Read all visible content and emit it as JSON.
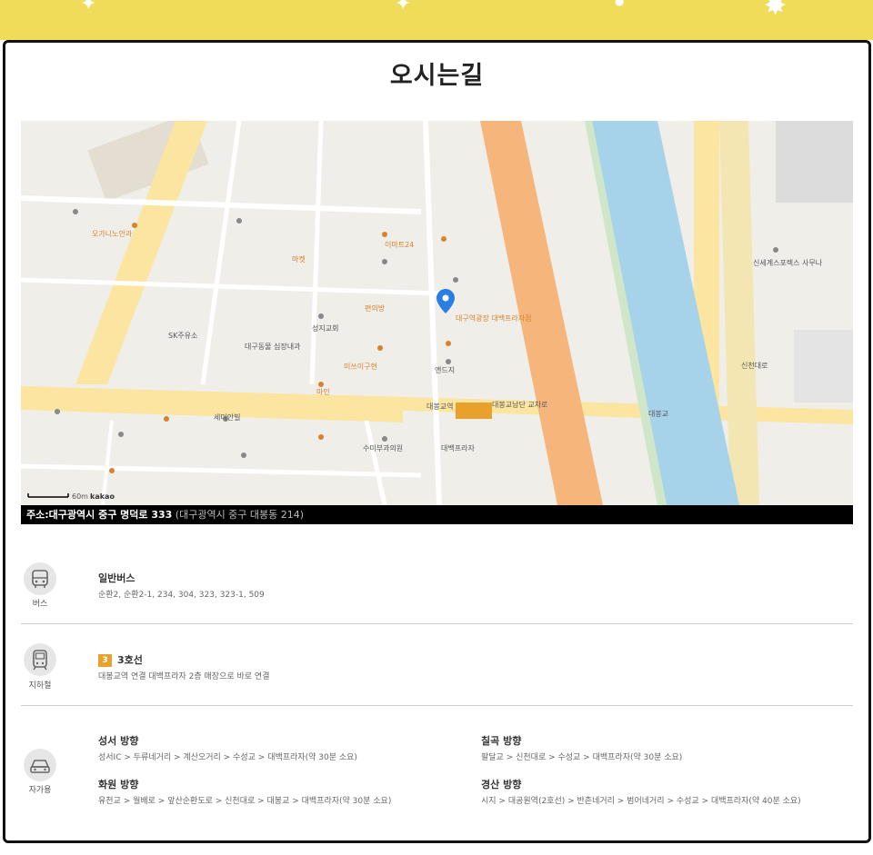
{
  "page": {
    "title": "오시는길"
  },
  "colors": {
    "banner": "#f1dc5a",
    "river": "#a7d3ea",
    "highway": "#f6b57a",
    "road": "#fbe5a0",
    "subway_line3": "#e8a22b",
    "marker": "#2a7de1"
  },
  "map": {
    "scale_text": "60m",
    "brand": "kakao",
    "pin_label": "대구역광장\n대백프라자점",
    "labels": [
      "대봉교남단 교차로",
      "대봉교",
      "신세계스포렉스 사무나",
      "신천대로",
      "대구동물 심장내과",
      "SK주유소",
      "세미안빌",
      "오가니노안과",
      "마인",
      "미쓰이구현",
      "성지교회",
      "엔드지",
      "대백프라자",
      "수미부과의원",
      "대봉교역",
      "이마트24",
      "편의방",
      "마켓"
    ]
  },
  "address": {
    "label": "주소:대구광역시 중구 명덕로 333",
    "sub": "(대구광역시 중구 대봉동 214)"
  },
  "sections": {
    "bus": {
      "icon_label": "버스",
      "title": "일반버스",
      "text": "순환2, 순환2-1, 234, 304, 323, 323-1, 509"
    },
    "subway": {
      "icon_label": "지하철",
      "badge": "3",
      "title": "3호선",
      "text": "대봉교역 연결 대백프라자 2층 매장으로 바로 연결"
    },
    "car": {
      "icon_label": "자가용",
      "routes": [
        {
          "title": "성서 방향",
          "text": "성서IC > 두류네거리 > 계산오거리 > 수성교 > 대백프라자(약 30분 소요)"
        },
        {
          "title": "칠곡 방향",
          "text": "팔달교 > 신천대로 > 수성교 > 대백프라자(약 30분 소요)"
        },
        {
          "title": "화원 방향",
          "text": "유천교 > 월배로 > 앞산순환도로 > 신천대로 > 대봉교 > 대백프라자(약 30분 소요)"
        },
        {
          "title": "경산 방향",
          "text": "시지 > 대공원역(2호선) > 반촌네거리 > 범어네거리 > 수성교 > 대백프라자(약 40분 소요)"
        }
      ]
    }
  }
}
